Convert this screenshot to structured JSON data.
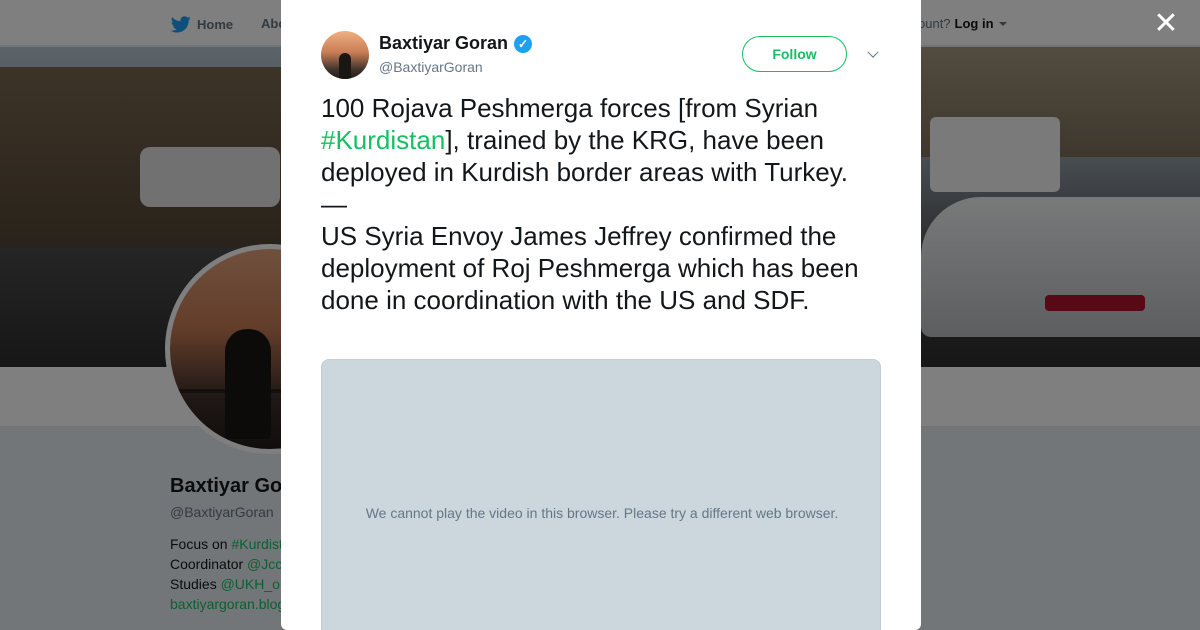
{
  "topbar": {
    "home_label": "Home",
    "about_label": "Abo",
    "account_prompt": "ccount?",
    "login_label": "Log in"
  },
  "profile": {
    "name": "Baxtiyar Go",
    "handle": "@BaxtiyarGoran",
    "bio_lines": [
      {
        "prefix": "Focus on ",
        "link": "#Kurdist"
      },
      {
        "prefix": "Coordinator ",
        "link": "@Jcc"
      },
      {
        "prefix": "Studies ",
        "link": "@UKH_o"
      },
      {
        "prefix": "",
        "link": "baxtiyargoran.blog"
      }
    ]
  },
  "modal": {
    "close_glyph": "✕",
    "author": {
      "name": "Baxtiyar Goran",
      "handle": "@BaxtiyarGoran",
      "verified_glyph": "✓"
    },
    "follow_label": "Follow",
    "tweet": {
      "line1_a": "100 Rojava Peshmerga forces [from Syrian ",
      "hashtag": "#Kurdistan",
      "line1_b": "], trained by the KRG, have been deployed in Kurdish border areas with Turkey.",
      "dash": "—",
      "paragraph2": "US Syria Envoy James Jeffrey confirmed the deployment of Roj Peshmerga which has been done in coordination with the US and SDF."
    },
    "video_message": "We cannot play the video in this browser. Please try a different web browser."
  },
  "colors": {
    "accent": "#17bf63",
    "verified": "#1da1f2",
    "text": "#14171a",
    "muted": "#657786"
  }
}
